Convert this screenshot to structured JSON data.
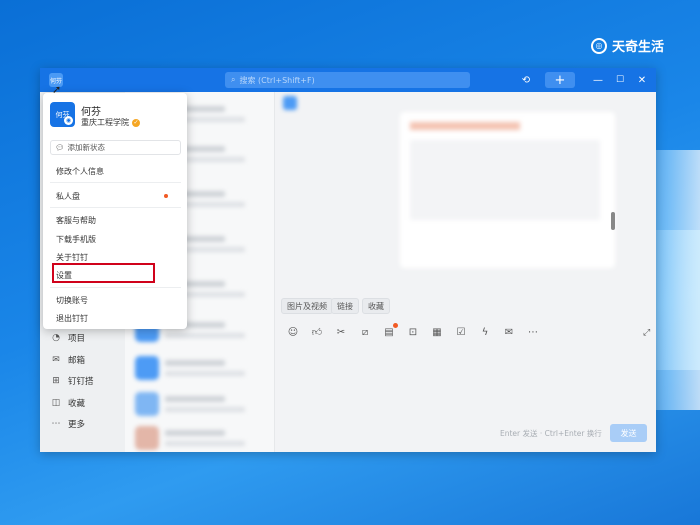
{
  "brand": {
    "text": "天奇生活"
  },
  "titlebar": {
    "avatar_text": "何芬",
    "search_placeholder": "搜索 (Ctrl+Shift+F)",
    "add_label": "+"
  },
  "profile_menu": {
    "name": "何芬",
    "org": "重庆工程学院",
    "avatar_text": "何芬",
    "status_label": "添加新状态",
    "items": [
      {
        "label": "修改个人信息"
      },
      {
        "label": "私人盘"
      },
      {
        "label": "客服与帮助"
      },
      {
        "label": "下载手机版"
      },
      {
        "label": "关于钉钉"
      },
      {
        "label": "设置"
      },
      {
        "label": "切换账号"
      },
      {
        "label": "退出钉钉"
      }
    ]
  },
  "sidebar": {
    "items": [
      {
        "label": "项目",
        "icon": "project-icon"
      },
      {
        "label": "邮箱",
        "icon": "mail-icon"
      },
      {
        "label": "钉钉搭",
        "icon": "builder-icon"
      },
      {
        "label": "收藏",
        "icon": "favorite-icon"
      },
      {
        "label": "更多",
        "icon": "more-icon"
      }
    ]
  },
  "chat": {
    "quick_tabs": [
      "图片及视频",
      "链接",
      "收藏"
    ],
    "input_hint": "Enter 发送 · Ctrl+Enter 换行",
    "send_label": "发送"
  },
  "colors": {
    "accent": "#1673e5",
    "highlight": "#d0021b"
  }
}
